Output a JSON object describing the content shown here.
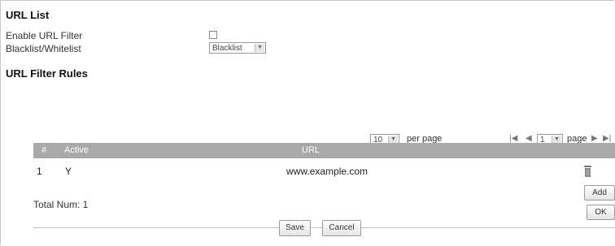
{
  "url_list": {
    "title": "URL List",
    "enable_label": "Enable URL Filter",
    "mode_label": "Blacklist/Whitelist",
    "mode_value": "Blacklist"
  },
  "rules": {
    "title": "URL Filter Rules",
    "pager": {
      "per_page_value": "10",
      "per_page_label": "per page",
      "page_value": "1",
      "page_label": "page"
    },
    "columns": [
      "#",
      "Active",
      "URL"
    ],
    "rows": [
      {
        "index": "1",
        "active": "Y",
        "url": "www.example.com"
      }
    ],
    "total": "Total Num: 1",
    "add_label": "Add",
    "ok_label": "OK"
  },
  "footer": {
    "save_label": "Save",
    "cancel_label": "Cancel"
  },
  "icons": {
    "first": "first-page-icon",
    "prev": "prev-page-icon",
    "next": "next-page-icon",
    "last": "last-page-icon",
    "delete": "trash-icon"
  }
}
